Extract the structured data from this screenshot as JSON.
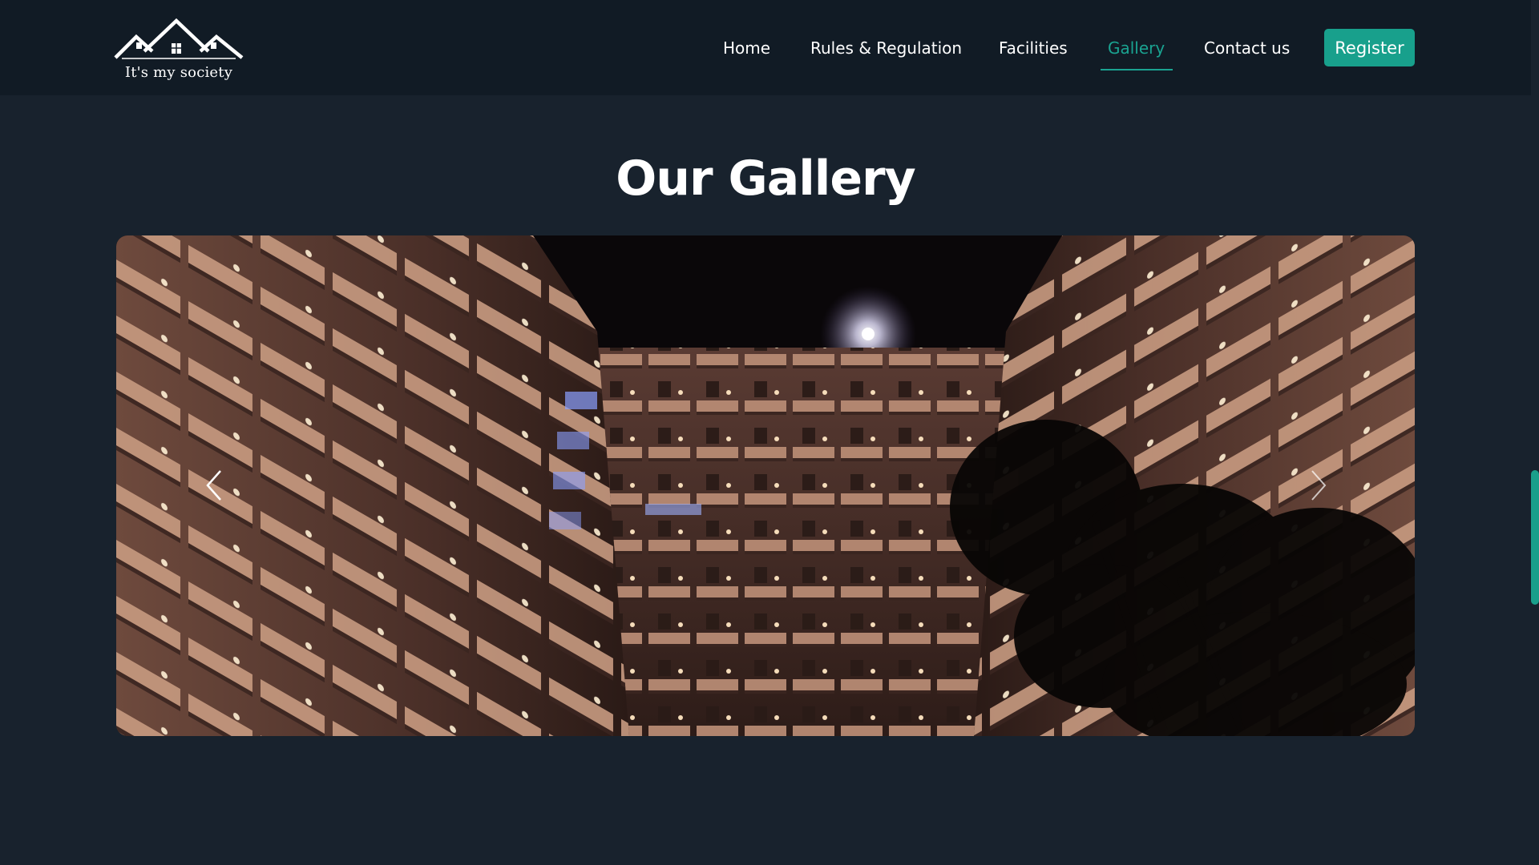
{
  "brand": {
    "tagline": "It's my society",
    "logo_icon": "houses-roof-icon"
  },
  "nav": {
    "items": [
      {
        "label": "Home",
        "active": false
      },
      {
        "label": "Rules & Regulation",
        "active": false
      },
      {
        "label": "Facilities",
        "active": false
      },
      {
        "label": "Gallery",
        "active": true
      },
      {
        "label": "Contact us",
        "active": false
      }
    ],
    "register_label": "Register"
  },
  "gallery": {
    "title": "Our Gallery",
    "prev_icon": "chevron-left-icon",
    "next_icon": "chevron-right-icon",
    "image": "night-apartment-building-photo"
  },
  "colors": {
    "accent": "#1aa391",
    "navbar_bg": "#111b25",
    "page_bg": "#18222d"
  }
}
